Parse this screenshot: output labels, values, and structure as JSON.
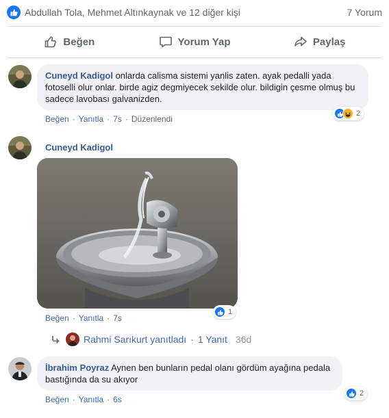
{
  "summary": {
    "reactors_text": "Abdullah Tola, Mehmet Altınkaynak ve 12 diğer kişi",
    "comment_count": "7 Yorum"
  },
  "actions": {
    "like": "Beğen",
    "comment": "Yorum Yap",
    "share": "Paylaş"
  },
  "comments": [
    {
      "author": "Cuneyd Kadigol",
      "text": "onlarda calisma sistemi yanlis zaten. ayak pedalli yada fotoselli olur onlar. birde agiz degmiyecek sekilde olur. bildigin çesme olmuş bu sadece lavobası galvanizden.",
      "like": "Beğen",
      "reply": "Yanıtla",
      "time": "7s",
      "edited": "Düzenlendi",
      "reaction_count": "2",
      "reactions": [
        "like-icon",
        "haha-icon"
      ]
    },
    {
      "author": "Cuneyd Kadigol",
      "photo": "drinking-fountain-photo",
      "like": "Beğen",
      "reply": "Yanıtla",
      "time": "7s",
      "reaction_count": "1",
      "reactions": [
        "like-icon"
      ],
      "replies": {
        "name": "Rahmi Sarıkurt yanıtladı",
        "count": "1 Yanıt",
        "time": "36d"
      }
    },
    {
      "author": "İbrahim Poyraz",
      "text": "Aynen ben bunların pedal olanı gördüm ayağına pedala bastığında da su akıyor",
      "like": "Beğen",
      "reply": "Yanıtla",
      "time": "6s",
      "reaction_count": "2",
      "reactions": [
        "like-icon"
      ]
    }
  ],
  "colors": {
    "accent": "#1877f2",
    "link": "#385898",
    "bubble": "#f0f2f5",
    "muted": "#606770"
  }
}
